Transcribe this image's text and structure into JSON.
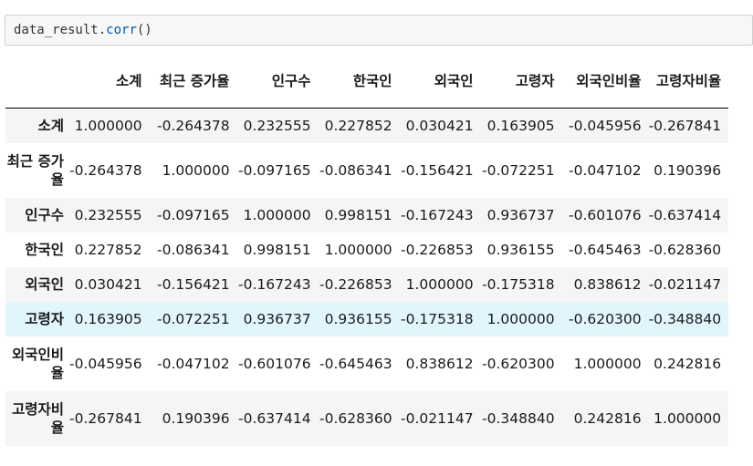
{
  "code": {
    "object": "data_result",
    "dot": ".",
    "method": "corr",
    "parens": "()"
  },
  "table": {
    "columns": [
      "소계",
      "최근 증가율",
      "인구수",
      "한국인",
      "외국인",
      "고령자",
      "외국인비율",
      "고령자비율"
    ],
    "rows": [
      {
        "label": "소계",
        "values": [
          "1.000000",
          "-0.264378",
          "0.232555",
          "0.227852",
          "0.030421",
          "0.163905",
          "-0.045956",
          "-0.267841"
        ]
      },
      {
        "label": "최근 증가율",
        "values": [
          "-0.264378",
          "1.000000",
          "-0.097165",
          "-0.086341",
          "-0.156421",
          "-0.072251",
          "-0.047102",
          "0.190396"
        ]
      },
      {
        "label": "인구수",
        "values": [
          "0.232555",
          "-0.097165",
          "1.000000",
          "0.998151",
          "-0.167243",
          "0.936737",
          "-0.601076",
          "-0.637414"
        ]
      },
      {
        "label": "한국인",
        "values": [
          "0.227852",
          "-0.086341",
          "0.998151",
          "1.000000",
          "-0.226853",
          "0.936155",
          "-0.645463",
          "-0.628360"
        ]
      },
      {
        "label": "외국인",
        "values": [
          "0.030421",
          "-0.156421",
          "-0.167243",
          "-0.226853",
          "1.000000",
          "-0.175318",
          "0.838612",
          "-0.021147"
        ]
      },
      {
        "label": "고령자",
        "values": [
          "0.163905",
          "-0.072251",
          "0.936737",
          "0.936155",
          "-0.175318",
          "1.000000",
          "-0.620300",
          "-0.348840"
        ]
      },
      {
        "label": "외국인비율",
        "values": [
          "-0.045956",
          "-0.047102",
          "-0.601076",
          "-0.645463",
          "0.838612",
          "-0.620300",
          "1.000000",
          "0.242816"
        ]
      },
      {
        "label": "고령자비율",
        "values": [
          "-0.267841",
          "0.190396",
          "-0.637414",
          "-0.628360",
          "-0.021147",
          "-0.348840",
          "0.242816",
          "1.000000"
        ]
      }
    ]
  }
}
